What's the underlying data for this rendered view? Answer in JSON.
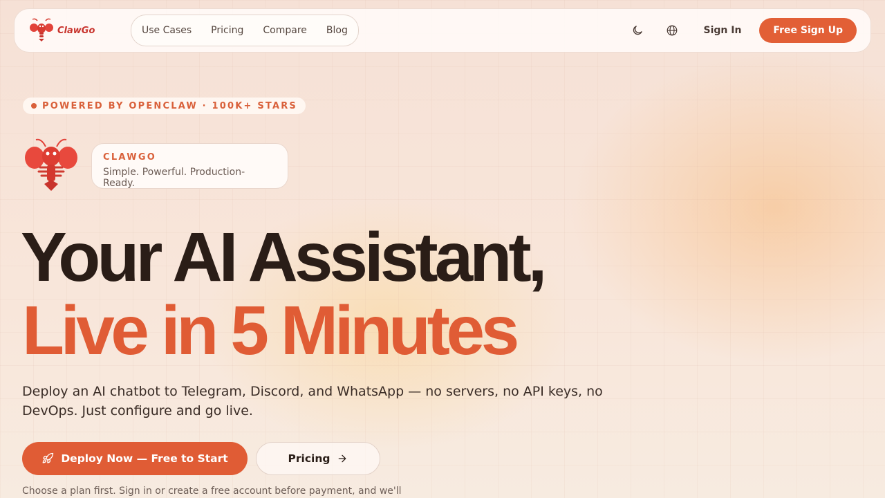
{
  "navbar": {
    "logo_text": "ClawGo",
    "links": [
      "Use Cases",
      "Pricing",
      "Compare",
      "Blog"
    ],
    "theme_icon": "moon-icon",
    "language_icon": "globe-icon",
    "sign_in": "Sign In",
    "sign_up": "Free Sign Up"
  },
  "hero": {
    "badge": "POWERED BY OPENCLAW · 100K+ STARS",
    "brand_name": "CLAWGO",
    "brand_tagline": "Simple. Powerful. Production-Ready.",
    "headline_line1": "Your AI Assistant,",
    "headline_line2": "Live in 5 Minutes",
    "description": "Deploy an AI chatbot to Telegram, Discord, and WhatsApp — no servers, no API keys, no DevOps. Just configure and go live.",
    "cta_primary": "Deploy Now — Free to Start",
    "cta_primary_icon": "rocket-icon",
    "cta_secondary": "Pricing",
    "cta_secondary_icon": "arrow-right-icon",
    "note": "Choose a plan first. Sign in or create a free account before payment, and we'll"
  },
  "colors": {
    "accent": "#e05c35",
    "logo_red": "#c8332c",
    "text_dark": "#2a1d17"
  }
}
